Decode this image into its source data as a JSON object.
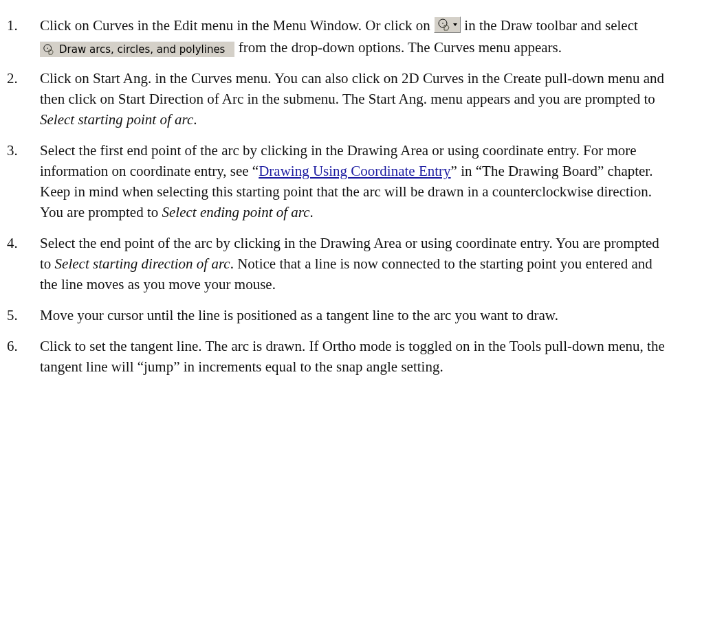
{
  "steps": [
    {
      "number": "1.",
      "parts": [
        {
          "kind": "text",
          "text": "Click on Curves in the Edit menu in the Menu Window. Or click on "
        },
        {
          "kind": "toolbar_button"
        },
        {
          "kind": "text",
          "text": " in the Draw toolbar and select "
        },
        {
          "kind": "menu_item",
          "text": "Draw arcs, circles, and polylines"
        },
        {
          "kind": "text",
          "text": " from the drop-down options. The Curves menu appears."
        }
      ]
    },
    {
      "number": "2.",
      "parts": [
        {
          "kind": "text",
          "text": "Click on Start Ang. in the Curves menu. You can also click on 2D Curves in the Create pull-down menu and then click on Start Direction of Arc in the submenu. The Start Ang. menu appears and you are prompted to *Select starting point of arc*."
        }
      ]
    },
    {
      "number": "3.",
      "parts": [
        {
          "kind": "text",
          "text": "Select the first end point of the arc by clicking in the Drawing Area or using coordinate entry. For more information on coordinate entry, see “"
        },
        {
          "kind": "link",
          "text": "Drawing Using Coordinate Entry"
        },
        {
          "kind": "text",
          "text": "” in “The Drawing Board” chapter. Keep in mind when selecting this starting point that the arc will be drawn in a counterclockwise direction. You are prompted to *Select ending point of arc*."
        }
      ]
    },
    {
      "number": "4.",
      "parts": [
        {
          "kind": "text",
          "text": "Select the end point of the arc by clicking in the Drawing Area or using coordinate entry. You are prompted to *Select starting direction of arc*. Notice that a line is now connected to the starting point you entered and the line moves as you move your mouse."
        }
      ]
    },
    {
      "number": "5.",
      "parts": [
        {
          "kind": "text",
          "text": "Move your cursor until the line is positioned as a tangent line to the arc you want to draw."
        }
      ]
    },
    {
      "number": "6.",
      "parts": [
        {
          "kind": "text",
          "text": "Click to set the tangent line. The arc is drawn. If Ortho mode is toggled on in the Tools pull-down menu, the tangent line will “jump” in increments equal to the snap angle setting."
        }
      ]
    }
  ]
}
